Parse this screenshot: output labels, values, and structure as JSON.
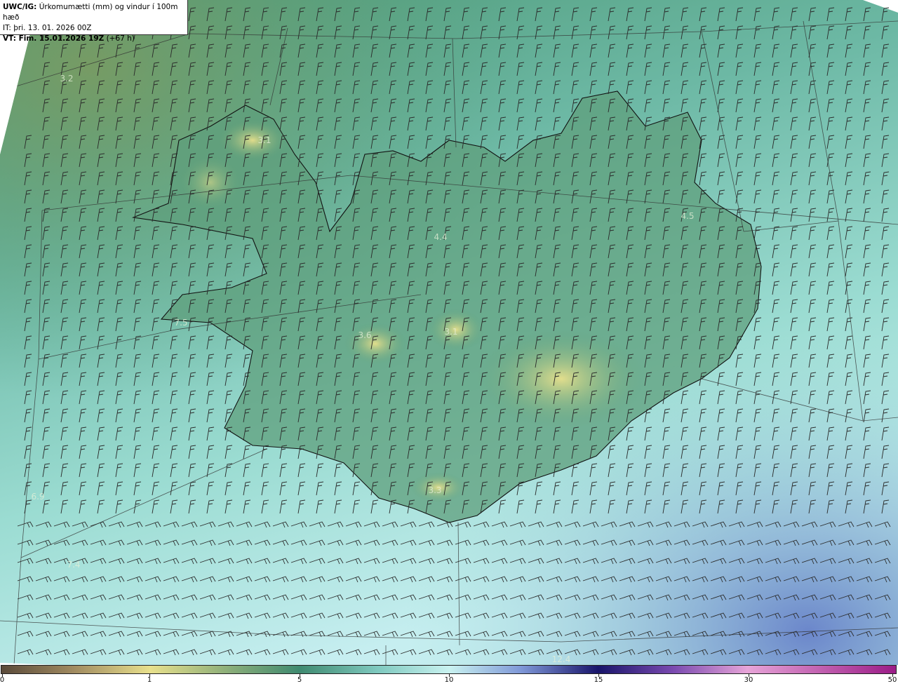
{
  "header": {
    "product": "UWC/IG:",
    "title": "Úrkomumætti (mm) og vindur í 100m hæð",
    "initial_time": "IT: þri. 13. 01. 2026 00Z",
    "valid_label": "VT: Fim. 15.01.2026 19Z",
    "lead": "(+67 h)"
  },
  "map_values": [
    {
      "text": "3.2"
    },
    {
      "text": "3.1"
    },
    {
      "text": "4.4"
    },
    {
      "text": "4.5"
    },
    {
      "text": "7.5"
    },
    {
      "text": "3.6"
    },
    {
      "text": "3.1"
    },
    {
      "text": "3.3"
    },
    {
      "text": "6.9"
    },
    {
      "text": "7.4"
    },
    {
      "text": "12.4"
    }
  ],
  "colorbar": {
    "ticks": [
      "0",
      "1",
      "5",
      "10",
      "15",
      "30",
      "50"
    ],
    "colors": {
      "low_brown": "#5a4a3a",
      "tan": "#c9b98a",
      "yellow": "#e8e08c",
      "green": "#4f9a78",
      "teal": "#7fc9bf",
      "cyan": "#c9f2f0",
      "blue": "#5b74c4",
      "navy": "#18146a",
      "purple": "#7a4ab0",
      "pink": "#e7a4d8",
      "magenta": "#9a1a86"
    }
  }
}
